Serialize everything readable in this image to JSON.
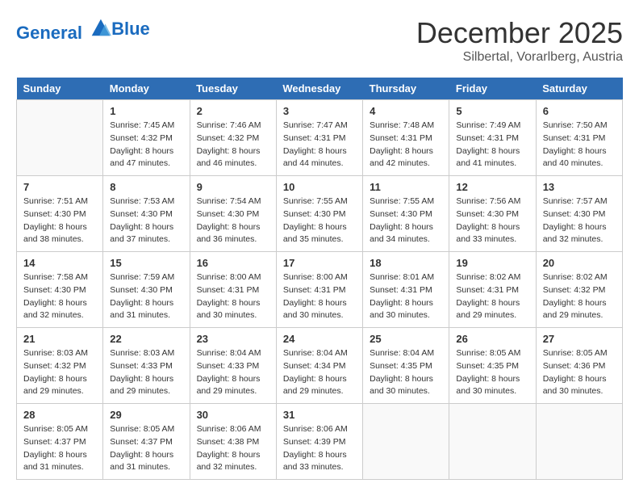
{
  "header": {
    "logo_line1": "General",
    "logo_line2": "Blue",
    "month": "December 2025",
    "location": "Silbertal, Vorarlberg, Austria"
  },
  "days_of_week": [
    "Sunday",
    "Monday",
    "Tuesday",
    "Wednesday",
    "Thursday",
    "Friday",
    "Saturday"
  ],
  "weeks": [
    [
      {
        "day": "",
        "detail": ""
      },
      {
        "day": "1",
        "detail": "Sunrise: 7:45 AM\nSunset: 4:32 PM\nDaylight: 8 hours\nand 47 minutes."
      },
      {
        "day": "2",
        "detail": "Sunrise: 7:46 AM\nSunset: 4:32 PM\nDaylight: 8 hours\nand 46 minutes."
      },
      {
        "day": "3",
        "detail": "Sunrise: 7:47 AM\nSunset: 4:31 PM\nDaylight: 8 hours\nand 44 minutes."
      },
      {
        "day": "4",
        "detail": "Sunrise: 7:48 AM\nSunset: 4:31 PM\nDaylight: 8 hours\nand 42 minutes."
      },
      {
        "day": "5",
        "detail": "Sunrise: 7:49 AM\nSunset: 4:31 PM\nDaylight: 8 hours\nand 41 minutes."
      },
      {
        "day": "6",
        "detail": "Sunrise: 7:50 AM\nSunset: 4:31 PM\nDaylight: 8 hours\nand 40 minutes."
      }
    ],
    [
      {
        "day": "7",
        "detail": "Sunrise: 7:51 AM\nSunset: 4:30 PM\nDaylight: 8 hours\nand 38 minutes."
      },
      {
        "day": "8",
        "detail": "Sunrise: 7:53 AM\nSunset: 4:30 PM\nDaylight: 8 hours\nand 37 minutes."
      },
      {
        "day": "9",
        "detail": "Sunrise: 7:54 AM\nSunset: 4:30 PM\nDaylight: 8 hours\nand 36 minutes."
      },
      {
        "day": "10",
        "detail": "Sunrise: 7:55 AM\nSunset: 4:30 PM\nDaylight: 8 hours\nand 35 minutes."
      },
      {
        "day": "11",
        "detail": "Sunrise: 7:55 AM\nSunset: 4:30 PM\nDaylight: 8 hours\nand 34 minutes."
      },
      {
        "day": "12",
        "detail": "Sunrise: 7:56 AM\nSunset: 4:30 PM\nDaylight: 8 hours\nand 33 minutes."
      },
      {
        "day": "13",
        "detail": "Sunrise: 7:57 AM\nSunset: 4:30 PM\nDaylight: 8 hours\nand 32 minutes."
      }
    ],
    [
      {
        "day": "14",
        "detail": "Sunrise: 7:58 AM\nSunset: 4:30 PM\nDaylight: 8 hours\nand 32 minutes."
      },
      {
        "day": "15",
        "detail": "Sunrise: 7:59 AM\nSunset: 4:30 PM\nDaylight: 8 hours\nand 31 minutes."
      },
      {
        "day": "16",
        "detail": "Sunrise: 8:00 AM\nSunset: 4:31 PM\nDaylight: 8 hours\nand 30 minutes."
      },
      {
        "day": "17",
        "detail": "Sunrise: 8:00 AM\nSunset: 4:31 PM\nDaylight: 8 hours\nand 30 minutes."
      },
      {
        "day": "18",
        "detail": "Sunrise: 8:01 AM\nSunset: 4:31 PM\nDaylight: 8 hours\nand 30 minutes."
      },
      {
        "day": "19",
        "detail": "Sunrise: 8:02 AM\nSunset: 4:31 PM\nDaylight: 8 hours\nand 29 minutes."
      },
      {
        "day": "20",
        "detail": "Sunrise: 8:02 AM\nSunset: 4:32 PM\nDaylight: 8 hours\nand 29 minutes."
      }
    ],
    [
      {
        "day": "21",
        "detail": "Sunrise: 8:03 AM\nSunset: 4:32 PM\nDaylight: 8 hours\nand 29 minutes."
      },
      {
        "day": "22",
        "detail": "Sunrise: 8:03 AM\nSunset: 4:33 PM\nDaylight: 8 hours\nand 29 minutes."
      },
      {
        "day": "23",
        "detail": "Sunrise: 8:04 AM\nSunset: 4:33 PM\nDaylight: 8 hours\nand 29 minutes."
      },
      {
        "day": "24",
        "detail": "Sunrise: 8:04 AM\nSunset: 4:34 PM\nDaylight: 8 hours\nand 29 minutes."
      },
      {
        "day": "25",
        "detail": "Sunrise: 8:04 AM\nSunset: 4:35 PM\nDaylight: 8 hours\nand 30 minutes."
      },
      {
        "day": "26",
        "detail": "Sunrise: 8:05 AM\nSunset: 4:35 PM\nDaylight: 8 hours\nand 30 minutes."
      },
      {
        "day": "27",
        "detail": "Sunrise: 8:05 AM\nSunset: 4:36 PM\nDaylight: 8 hours\nand 30 minutes."
      }
    ],
    [
      {
        "day": "28",
        "detail": "Sunrise: 8:05 AM\nSunset: 4:37 PM\nDaylight: 8 hours\nand 31 minutes."
      },
      {
        "day": "29",
        "detail": "Sunrise: 8:05 AM\nSunset: 4:37 PM\nDaylight: 8 hours\nand 31 minutes."
      },
      {
        "day": "30",
        "detail": "Sunrise: 8:06 AM\nSunset: 4:38 PM\nDaylight: 8 hours\nand 32 minutes."
      },
      {
        "day": "31",
        "detail": "Sunrise: 8:06 AM\nSunset: 4:39 PM\nDaylight: 8 hours\nand 33 minutes."
      },
      {
        "day": "",
        "detail": ""
      },
      {
        "day": "",
        "detail": ""
      },
      {
        "day": "",
        "detail": ""
      }
    ]
  ]
}
